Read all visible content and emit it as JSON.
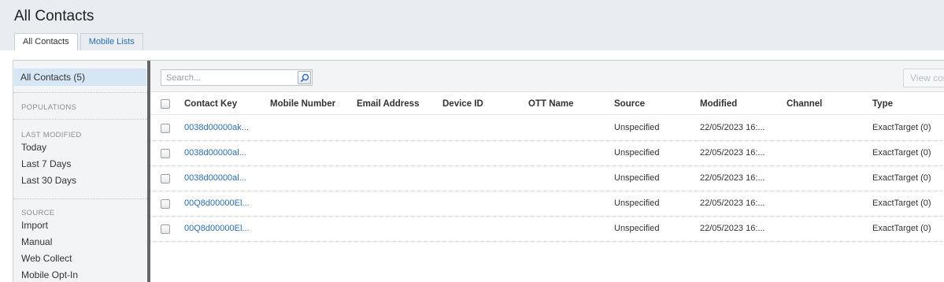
{
  "page_title": "All Contacts",
  "tabs": [
    {
      "label": "All Contacts",
      "active": true
    },
    {
      "label": "Mobile Lists",
      "active": false
    }
  ],
  "sidebar": {
    "selected": "All Contacts  (5)",
    "populations_heading": "POPULATIONS",
    "last_modified_heading": "LAST MODIFIED",
    "last_modified_items": [
      "Today",
      "Last 7 Days",
      "Last 30 Days"
    ],
    "source_heading": "SOURCE",
    "source_items": [
      "Import",
      "Manual",
      "Web Collect",
      "Mobile Opt-In"
    ]
  },
  "toolbar": {
    "search_placeholder": "Search...",
    "search_icon": "search-icon",
    "view_button_label": "View con"
  },
  "table": {
    "columns": [
      "Contact Key",
      "Mobile Number",
      "Email Address",
      "Device ID",
      "OTT Name",
      "Source",
      "Modified",
      "Channel",
      "Type"
    ],
    "rows": [
      {
        "contact_key": "0038d00000ak...",
        "mobile_number": "",
        "email_address": "",
        "device_id": "",
        "ott_name": "",
        "source": "Unspecified",
        "modified": "22/05/2023 16:...",
        "channel": "",
        "type": "ExactTarget (0)"
      },
      {
        "contact_key": "0038d00000al...",
        "mobile_number": "",
        "email_address": "",
        "device_id": "",
        "ott_name": "",
        "source": "Unspecified",
        "modified": "22/05/2023 16:...",
        "channel": "",
        "type": "ExactTarget (0)"
      },
      {
        "contact_key": "0038d00000al...",
        "mobile_number": "",
        "email_address": "",
        "device_id": "",
        "ott_name": "",
        "source": "Unspecified",
        "modified": "22/05/2023 16:...",
        "channel": "",
        "type": "ExactTarget (0)"
      },
      {
        "contact_key": "00Q8d00000El...",
        "mobile_number": "",
        "email_address": "",
        "device_id": "",
        "ott_name": "",
        "source": "Unspecified",
        "modified": "22/05/2023 16:...",
        "channel": "",
        "type": "ExactTarget (0)"
      },
      {
        "contact_key": "00Q8d00000El...",
        "mobile_number": "",
        "email_address": "",
        "device_id": "",
        "ott_name": "",
        "source": "Unspecified",
        "modified": "22/05/2023 16:...",
        "channel": "",
        "type": "ExactTarget (0)"
      }
    ]
  },
  "colors": {
    "link": "#2a6ebb",
    "selected_bg": "#d6e6f5",
    "header_bg": "#e9edf1"
  }
}
